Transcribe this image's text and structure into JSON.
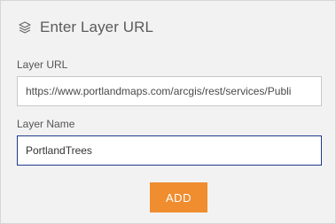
{
  "dialog": {
    "title": "Enter Layer URL",
    "title_icon": "layers-icon"
  },
  "form": {
    "layer_url": {
      "label": "Layer URL",
      "value": "https://www.portlandmaps.com/arcgis/rest/services/Publi"
    },
    "layer_name": {
      "label": "Layer Name",
      "value": "PortlandTrees"
    },
    "add_button_label": "ADD"
  },
  "colors": {
    "accent_button": "#ef8d2f",
    "focus_border": "#1e3a8a",
    "panel_background": "#f2f2f2"
  }
}
